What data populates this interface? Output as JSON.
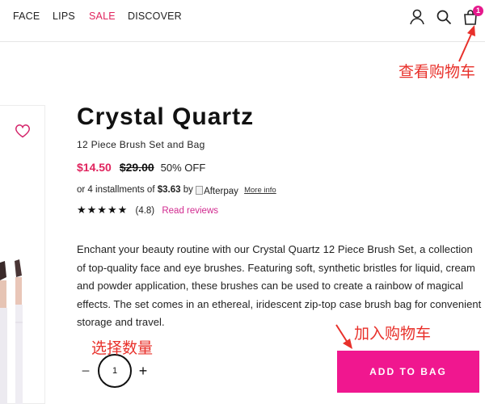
{
  "nav": {
    "links": [
      {
        "label": "FACE"
      },
      {
        "label": "LIPS"
      },
      {
        "label": "SALE"
      },
      {
        "label": "DISCOVER"
      }
    ],
    "cart_count": "1"
  },
  "product": {
    "title": "Crystal Quartz",
    "subtitle": "12 Piece Brush Set and Bag",
    "price_sale": "$14.50",
    "price_original": "$29.00",
    "discount": "50% OFF",
    "installments_prefix": "or 4 installments of",
    "installments_amount": "$3.63",
    "installments_by": "by",
    "afterpay_label": "Afterpay",
    "more_info": "More info",
    "stars": "★★★★★",
    "rating": "(4.8)",
    "read_reviews": "Read reviews",
    "description": "Enchant your beauty routine with our Crystal Quartz 12 Piece Brush Set, a collection of top-quality face and eye brushes. Featuring soft, synthetic bristles for liquid, cream and powder application, these brushes can be used to create a rainbow of magical effects. The set comes in an ethereal, iridescent zip-top case brush bag for convenient storage and travel."
  },
  "purchase": {
    "qty_minus": "−",
    "quantity": "1",
    "qty_plus": "+",
    "add_to_bag": "ADD TO BAG"
  },
  "annotations": {
    "view_cart": "查看购物车",
    "select_quantity": "选择数量",
    "add_to_cart": "加入购物车"
  },
  "colors": {
    "accent_pink": "#f0178f",
    "sale_red": "#e0245e",
    "annotation_red": "#e8302a"
  },
  "icons": [
    "account-icon",
    "search-icon",
    "shopping-bag-icon",
    "heart-icon"
  ]
}
